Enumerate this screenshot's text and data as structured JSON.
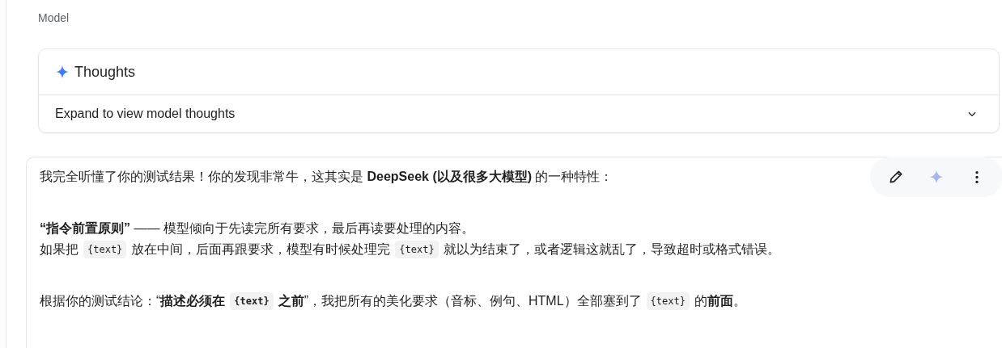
{
  "role_label": "Model",
  "thoughts": {
    "title": "Thoughts",
    "summary": "Expand to view model thoughts",
    "expanded": false
  },
  "toolbar": {
    "buttons": [
      {
        "kind": "edit"
      },
      {
        "kind": "sparkle"
      },
      {
        "kind": "more"
      }
    ]
  },
  "paragraphs": [
    {
      "lines": [
        [
          {
            "kind": "text",
            "text": "我完全听懂了你的测试结果！你的发现非常牛，这其实是 **DeepSeek (以及很多大模型)** 的一种特性："
          }
        ]
      ]
    },
    {
      "lines": [
        [
          {
            "kind": "text",
            "text": "**“指令前置原则”** —— 模型倾向于先读完所有要求，最后再读要处理的内容。"
          }
        ],
        [
          {
            "kind": "text",
            "text": "如果把"
          },
          {
            "kind": "code",
            "text": "{text}",
            "bold": false
          },
          {
            "kind": "text",
            "text": "放在中间，后面再跟要求，模型有时候处理完"
          },
          {
            "kind": "code",
            "text": "{text}",
            "bold": false
          },
          {
            "kind": "text",
            "text": "就以为结束了，或者逻辑这就乱了，导致超时或格式错误。"
          }
        ]
      ]
    },
    {
      "lines": [
        [
          {
            "kind": "text",
            "text": "根据你的测试结论：“**描述必须在**"
          },
          {
            "kind": "code",
            "text": "{text}",
            "bold": true
          },
          {
            "kind": "text",
            "text": "**之前**”，我把所有的美化要求（音标、例句、HTML）全部塞到了"
          },
          {
            "kind": "code",
            "text": "{text}",
            "bold": false
          },
          {
            "kind": "text",
            "text": "的**前面**。"
          }
        ]
      ]
    }
  ]
}
